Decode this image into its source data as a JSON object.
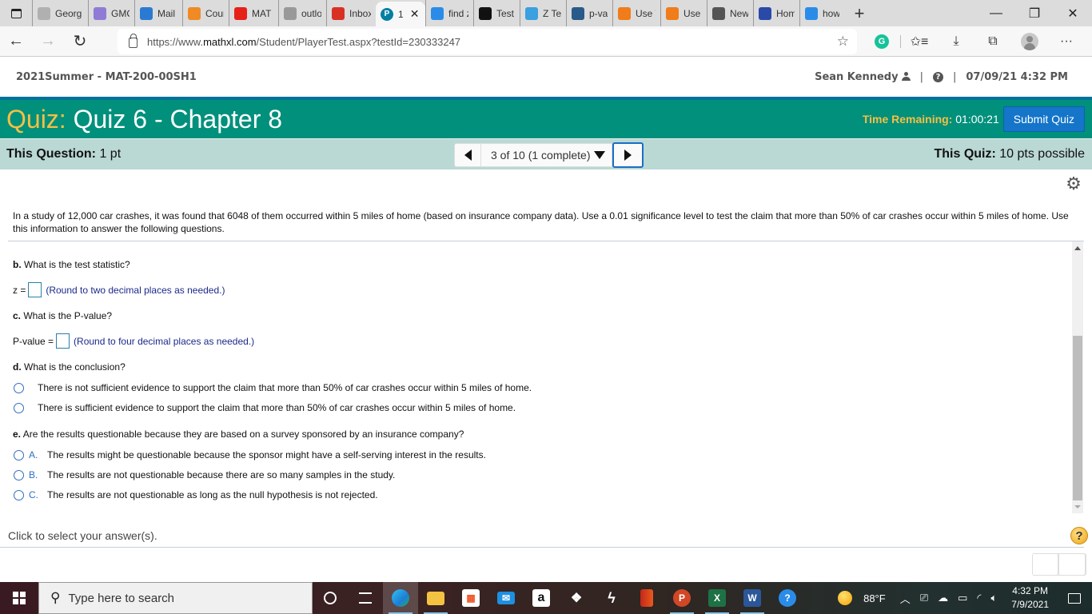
{
  "browser": {
    "tabs": [
      {
        "label": "Georg",
        "icon": "gmc-logo-icon",
        "color": "#b0b0b0",
        "active": false
      },
      {
        "label": "GMC",
        "icon": "circle-check-icon",
        "color": "#8f7bd6",
        "active": false
      },
      {
        "label": "Mail",
        "icon": "outlook-icon",
        "color": "#2a7ad2",
        "active": false
      },
      {
        "label": "Cours",
        "icon": "moodle-icon",
        "color": "#f08a24",
        "active": false
      },
      {
        "label": "MAT",
        "icon": "youtube-icon",
        "color": "#e62117",
        "active": false
      },
      {
        "label": "outlo",
        "icon": "file-icon",
        "color": "#999999",
        "active": false
      },
      {
        "label": "Inbox",
        "icon": "gmail-icon",
        "color": "#d93025",
        "active": false
      },
      {
        "label": "1",
        "icon": "pearson-icon",
        "color": "#007fa3",
        "active": true
      },
      {
        "label": "find z",
        "icon": "bing-icon",
        "color": "#2a8ce8",
        "active": false
      },
      {
        "label": "Test S",
        "icon": "l-logo-icon",
        "color": "#111111",
        "active": false
      },
      {
        "label": "Z Tes",
        "icon": "z-test-icon",
        "color": "#3aa0e0",
        "active": false
      },
      {
        "label": "p-val",
        "icon": "p-value-icon",
        "color": "#2a5a8a",
        "active": false
      },
      {
        "label": "Use T",
        "icon": "c-logo-icon",
        "color": "#f07c1a",
        "active": false
      },
      {
        "label": "Use T",
        "icon": "c-logo-icon",
        "color": "#f07c1a",
        "active": false
      },
      {
        "label": "New",
        "icon": "new-tab-icon",
        "color": "#555555",
        "active": false
      },
      {
        "label": "Hom",
        "icon": "shield-star-icon",
        "color": "#2a4aa8",
        "active": false
      },
      {
        "label": "how",
        "icon": "bing-icon",
        "color": "#2a8ce8",
        "active": false
      }
    ],
    "active_tab_close": "✕",
    "new_tab": "+",
    "window_controls": {
      "minimize": "—",
      "restore": "❐",
      "close": "✕"
    },
    "url_host_prefix": "https://www.",
    "url_host": "mathxl.com",
    "url_path": "/Student/PlayerTest.aspx?testId=230333247"
  },
  "course": {
    "title": "2021Summer - MAT-200-00SH1",
    "user": "Sean Kennedy",
    "separator": "|",
    "help": "?",
    "datetime": "07/09/21 4:32 PM"
  },
  "quiz": {
    "label": "Quiz:",
    "title": "Quiz 6 - Chapter 8",
    "time_label": "Time Remaining:",
    "time_value": "01:00:21",
    "submit_label": "Submit Quiz",
    "colors": {
      "header": "#00907c",
      "accent": "#f5c044",
      "submit": "#1475c9",
      "subbar": "#bad8d4"
    }
  },
  "question_bar": {
    "this_question_label": "This Question:",
    "this_question_value": "1 pt",
    "position": "3 of 10 (1 complete)",
    "this_quiz_label": "This Quiz:",
    "this_quiz_value": "10 pts possible"
  },
  "problem": {
    "statement": "In a study of 12,000 car crashes, it was found that 6048 of them occurred within 5 miles of home (based on insurance company data). Use a 0.01 significance level to test the claim that more than 50% of car crashes occur within 5 miles of home. Use this information to answer the following questions."
  },
  "parts": {
    "b": {
      "letter": "b.",
      "question": "What is the test statistic?",
      "input_label": "z =",
      "input_value": "",
      "hint": "(Round to two decimal places as needed.)"
    },
    "c": {
      "letter": "c.",
      "question": "What is the P-value?",
      "input_label": "P-value =",
      "input_value": "",
      "hint": "(Round to four decimal places as needed.)"
    },
    "d": {
      "letter": "d.",
      "question": "What is the conclusion?",
      "options": [
        {
          "text": "There is not sufficient evidence to support the claim that more than 50% of car crashes occur within 5 miles of home.",
          "selected": false
        },
        {
          "text": "There is sufficient evidence to support the claim that more than 50% of car crashes occur within 5 miles of home.",
          "selected": false
        }
      ]
    },
    "e": {
      "letter": "e.",
      "question": "Are the results questionable because they are based on a survey sponsored by an insurance company?",
      "options": [
        {
          "letter": "A.",
          "text": "The results might be questionable because the sponsor might have a self-serving interest in the results.",
          "selected": false
        },
        {
          "letter": "B.",
          "text": "The results are not questionable because there are so many samples in the study.",
          "selected": false
        },
        {
          "letter": "C.",
          "text": "The results are not questionable as long as the null hypothesis is not rejected.",
          "selected": false
        }
      ]
    }
  },
  "footer": {
    "hint": "Click to select your answer(s).",
    "help": "?"
  },
  "taskbar": {
    "search_placeholder": "Type here to search",
    "apps": [
      "edge-icon",
      "file-explorer-icon",
      "microsoft-store-icon",
      "mail-icon",
      "amazon-icon",
      "dropbox-icon",
      "pen-icon",
      "office-icon",
      "powerpoint-icon",
      "excel-icon",
      "word-icon",
      "help-alert-icon"
    ],
    "weather": "88°F",
    "time": "4:32 PM",
    "date": "7/9/2021"
  }
}
